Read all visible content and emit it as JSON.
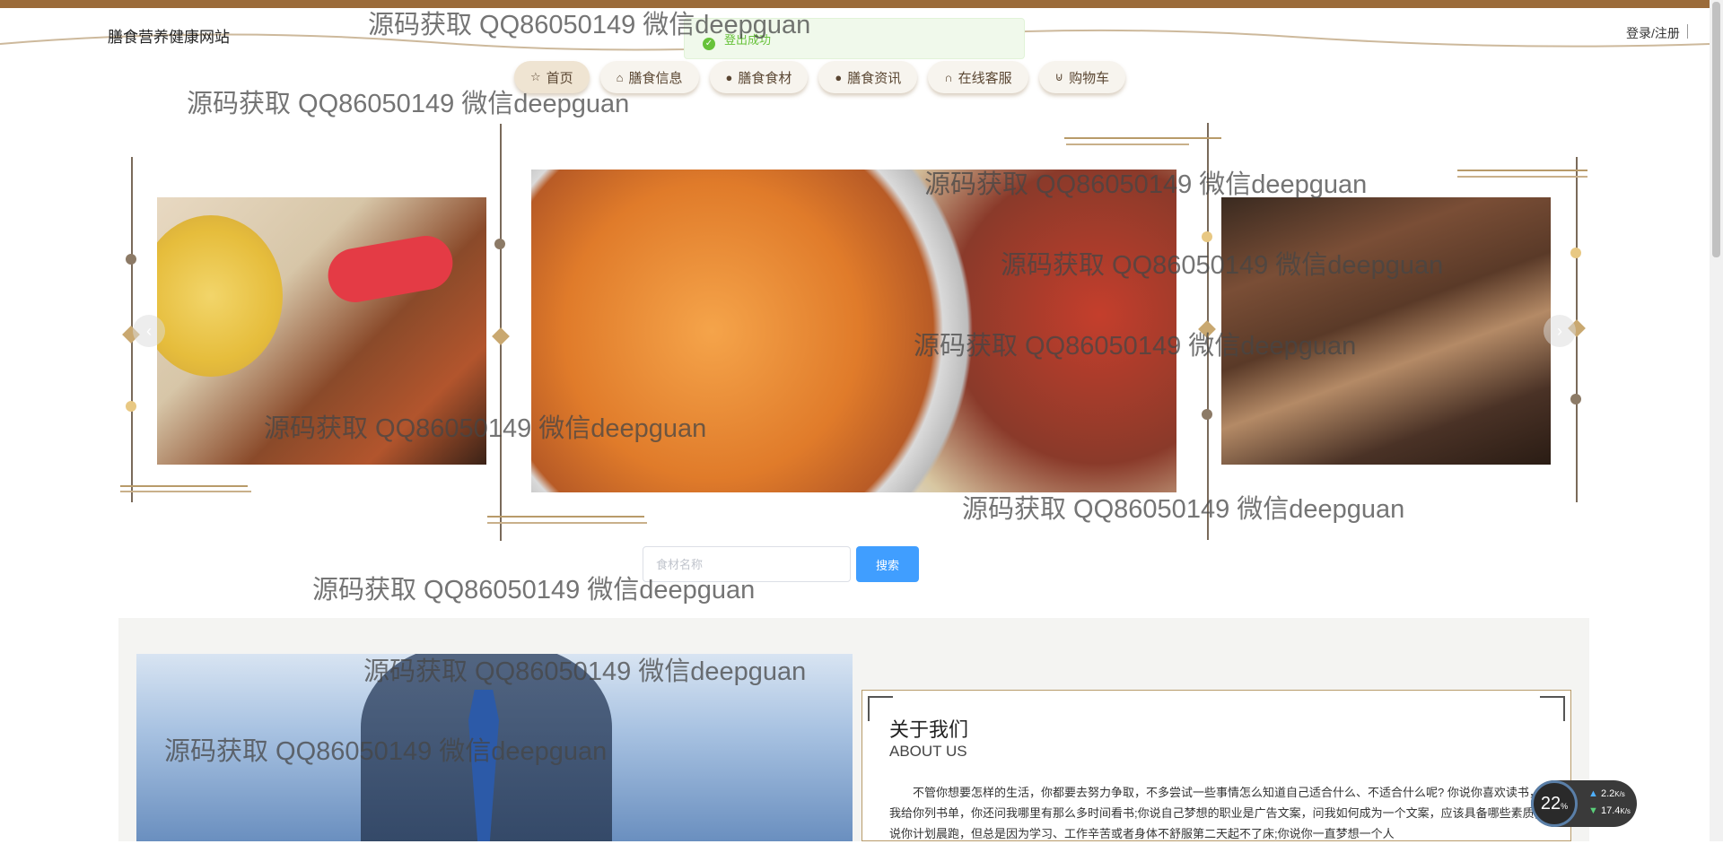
{
  "header": {
    "site_title": "膳食营养健康网站",
    "login_label": "登录/注册"
  },
  "toast": {
    "message": "登出成功"
  },
  "nav": {
    "items": [
      {
        "label": "首页",
        "icon": "star-icon"
      },
      {
        "label": "膳食信息",
        "icon": "bag-icon"
      },
      {
        "label": "膳食食材",
        "icon": "info-icon"
      },
      {
        "label": "膳食资讯",
        "icon": "question-icon"
      },
      {
        "label": "在线客服",
        "icon": "headset-icon"
      },
      {
        "label": "购物车",
        "icon": "cart-icon"
      }
    ]
  },
  "search": {
    "placeholder": "食材名称",
    "button_label": "搜索"
  },
  "about": {
    "title": "关于我们",
    "subtitle": "ABOUT US",
    "text": "不管你想要怎样的生活，你都要去努力争取，不多尝试一些事情怎么知道自己适合什么、不适合什么呢? 你说你喜欢读书，让我给你列书单，你还问我哪里有那么多时间看书;你说自己梦想的职业是广告文案，问我如何成为一个文案，应该具备哪些素质;你说你计划晨跑，但总是因为学习、工作辛苦或者身体不舒服第二天起不了床;你说你一直梦想一个人"
  },
  "watermark": "源码获取 QQ86050149 微信deepguan",
  "speed_widget": {
    "percent": "22",
    "up": "2.2",
    "down": "17.4",
    "unit": "K/s"
  },
  "colors": {
    "brand": "#9b6b3a",
    "accent": "#409eff",
    "success": "#67c23a"
  }
}
